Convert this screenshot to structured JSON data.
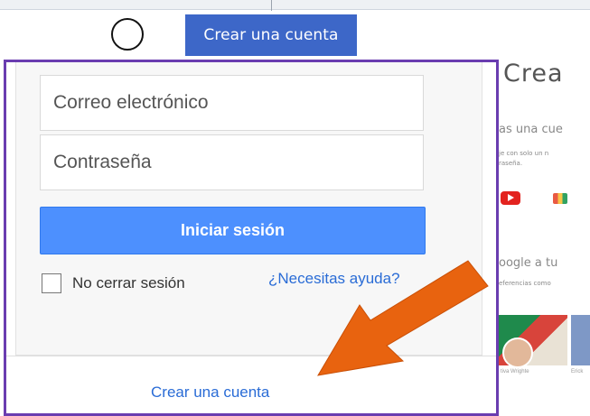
{
  "header": {
    "create_account_label": "Crear una cuenta"
  },
  "login": {
    "email_placeholder": "Correo electrónico",
    "password_placeholder": "Contraseña",
    "signin_label": "Iniciar sesión",
    "remember_label": "No cerrar sesión",
    "help_label": "¿Necesitas ayuda?",
    "create_account_link": "Crear una cuenta"
  },
  "background_page": {
    "title": "Crea",
    "subtitle1": "as una cue",
    "small_line1": "je con solo un n",
    "small_line2": "raseña.",
    "subtitle2": "oogle a tu",
    "small_line3": "eferencias como",
    "caption1": "tiva Wrighte",
    "caption2": "Erick"
  },
  "icons": [
    "circle-marker",
    "youtube-icon",
    "photos-icon",
    "orange-arrow-icon"
  ],
  "colors": {
    "header_button": "#3d67c8",
    "signin_button": "#4d90fe",
    "frame_border": "#6a3db0",
    "link": "#2a6cd6",
    "arrow": "#e8630f"
  }
}
